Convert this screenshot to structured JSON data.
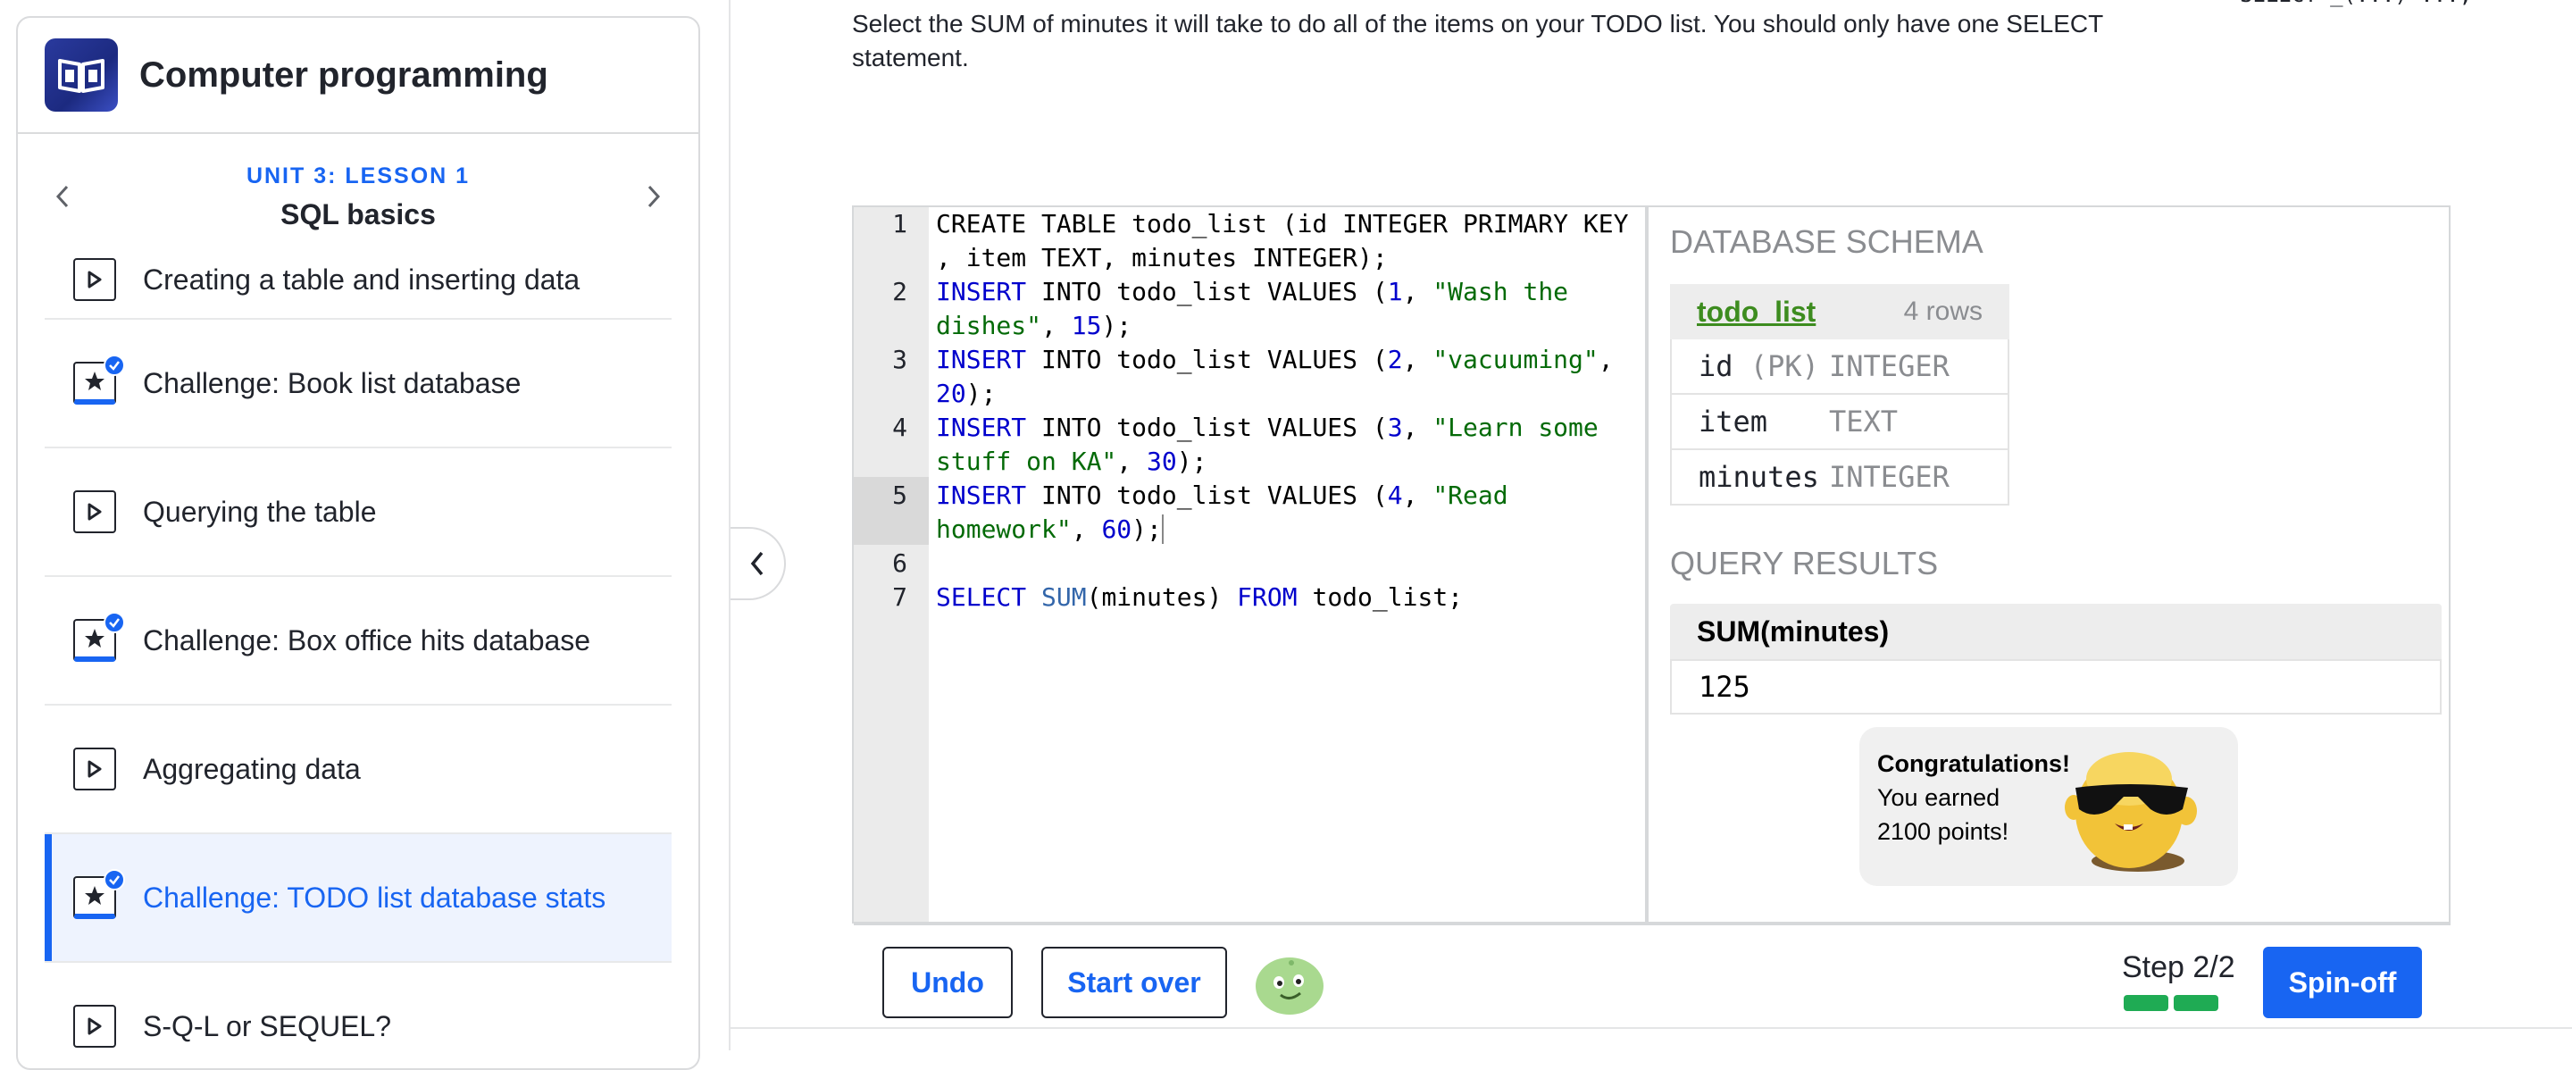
{
  "sidebar": {
    "course_title": "Computer programming",
    "unit_label": "UNIT 3: LESSON 1",
    "unit_title": "SQL basics",
    "lessons": [
      {
        "label": "Creating a table and inserting data",
        "type": "video",
        "completed": false
      },
      {
        "label": "Challenge: Book list database",
        "type": "challenge",
        "completed": true
      },
      {
        "label": "Querying the table",
        "type": "video",
        "completed": false
      },
      {
        "label": "Challenge: Box office hits database",
        "type": "challenge",
        "completed": true
      },
      {
        "label": "Aggregating data",
        "type": "video",
        "completed": false
      },
      {
        "label": "Challenge: TODO list database stats",
        "type": "challenge",
        "completed": true,
        "active": true
      },
      {
        "label": "S-Q-L or SEQUEL?",
        "type": "video",
        "completed": false
      }
    ]
  },
  "instructions": {
    "line1": "Select the SUM of minutes it will take to do all of the items on your TODO list. You should only have one SELECT",
    "line2": "statement.",
    "hint_code": "SELECT _(...) ...;"
  },
  "editor": {
    "lines": [
      {
        "n": "1",
        "text": "CREATE TABLE todo_list (id INTEGER PRIMARY KEY , item TEXT, minutes INTEGER);"
      },
      {
        "n": "2",
        "text": "INSERT INTO todo_list VALUES (1, \"Wash the dishes\", 15);"
      },
      {
        "n": "3",
        "text": "INSERT INTO todo_list VALUES (2, \"vacuuming\", 20);"
      },
      {
        "n": "4",
        "text": "INSERT INTO todo_list VALUES (3, \"Learn some stuff on KA\", 30);"
      },
      {
        "n": "5",
        "text": "INSERT INTO todo_list VALUES (4, \"Read homework\", 60);"
      },
      {
        "n": "6",
        "text": ""
      },
      {
        "n": "7",
        "text": "SELECT SUM(minutes) FROM todo_list;"
      }
    ]
  },
  "schema": {
    "title": "DATABASE SCHEMA",
    "table_name": "todo_list",
    "row_count": "4 rows",
    "columns": [
      {
        "name": "id",
        "pk": "(PK)",
        "type": "INTEGER"
      },
      {
        "name": "item",
        "pk": "",
        "type": "TEXT"
      },
      {
        "name": "minutes",
        "pk": "",
        "type": "INTEGER"
      }
    ]
  },
  "results": {
    "title": "QUERY RESULTS",
    "column": "SUM(minutes)",
    "value": "125"
  },
  "congrats": {
    "title": "Congratulations!",
    "line2": "You earned",
    "line3": "2100 points!"
  },
  "footer": {
    "undo_label": "Undo",
    "start_over_label": "Start over",
    "step_label": "Step 2/2",
    "spinoff_label": "Spin-off"
  },
  "colors": {
    "accent": "#1865f2",
    "success": "#1fab54",
    "schema_link": "#3d8c1f"
  }
}
